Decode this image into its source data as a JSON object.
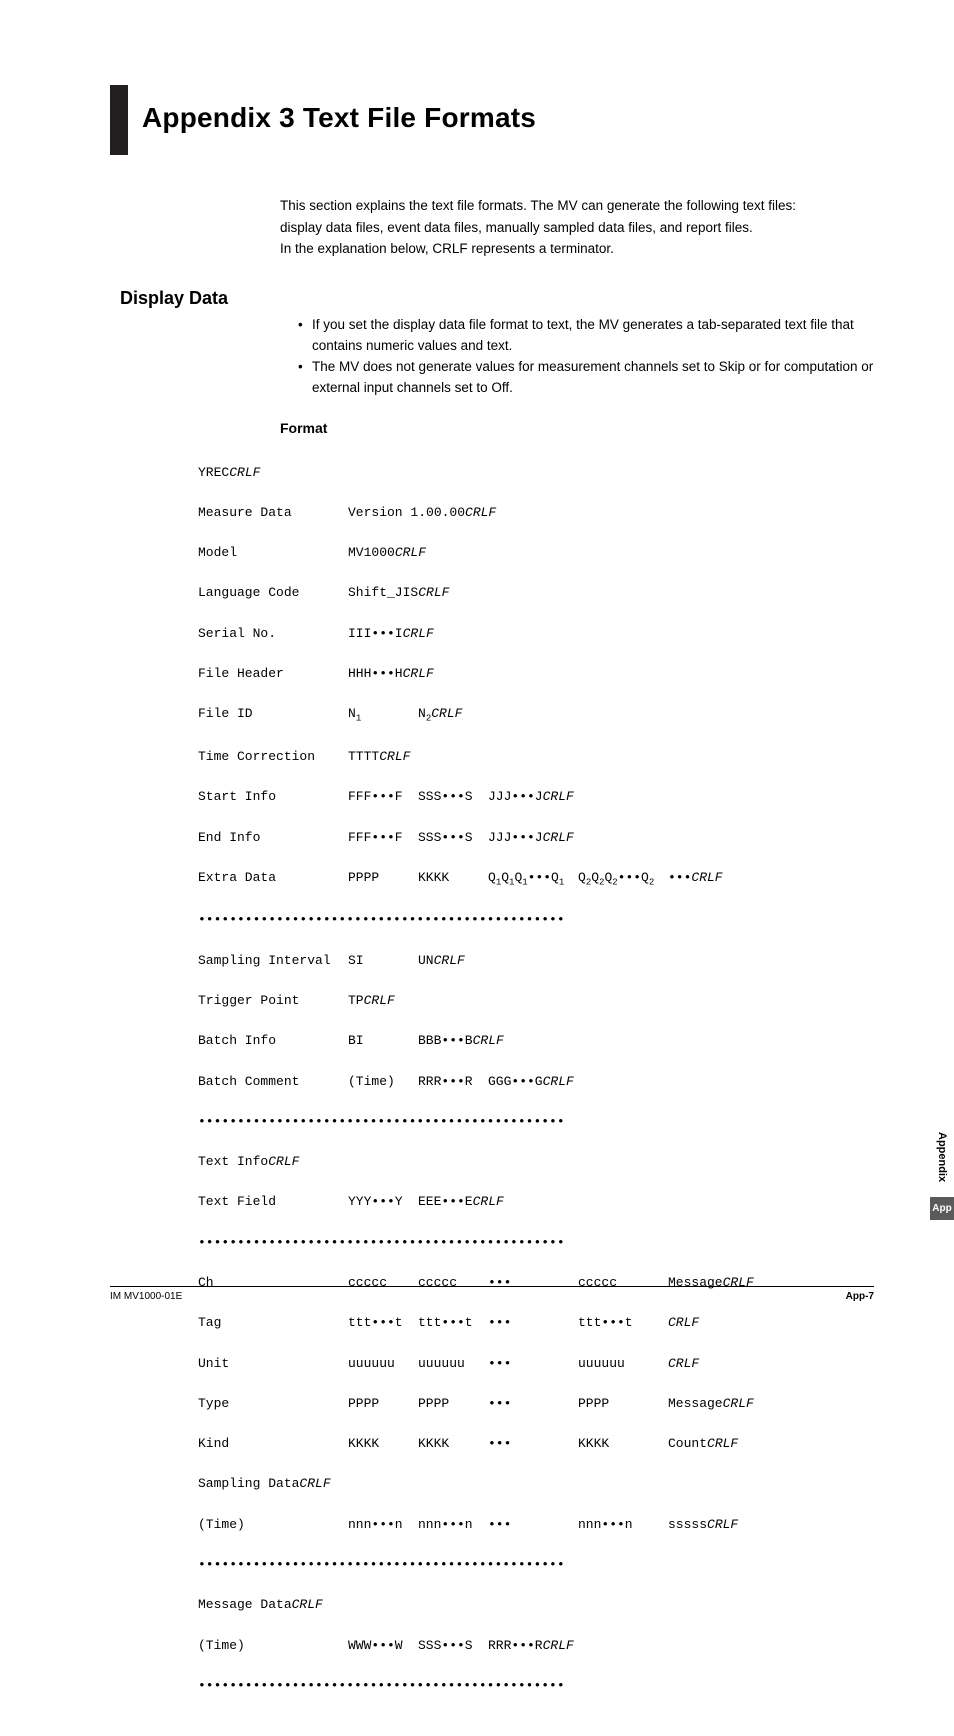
{
  "heading": "Appendix 3  Text File Formats",
  "intro_lines": [
    "This section explains the text file formats. The MV can generate the following text files:",
    "display data files, event data files, manually sampled data files, and report files.",
    "In the explanation below, CRLF represents a terminator."
  ],
  "h2": "Display Data",
  "bullets": [
    "If you set the display data file format to text, the MV generates a tab-separated text file that contains numeric values and text.",
    "The MV does not generate values for measurement channels set to Skip or for computation or external input channels set to Off."
  ],
  "h3": "Format",
  "fmt": {
    "r1": {
      "t": "YREC"
    },
    "r2": {
      "l": "Measure Data",
      "c1": "Version 1.00.00"
    },
    "r3": {
      "l": "Model",
      "c1": "MV1000"
    },
    "r4": {
      "l": "Language Code",
      "c1": "Shift_JIS"
    },
    "r5": {
      "l": "Serial No.",
      "c1": "III•••I"
    },
    "r6": {
      "l": "File Header",
      "c1": "HHH•••H"
    },
    "r7": {
      "l": "File ID",
      "c1": "N",
      "c2": "N"
    },
    "r8": {
      "l": "Time Correction",
      "c1": "TTTT"
    },
    "r9": {
      "l": "Start Info",
      "c1": "FFF•••F",
      "c2": "SSS•••S",
      "c3": "JJJ•••J"
    },
    "r10": {
      "l": "End Info",
      "c1": "FFF•••F",
      "c2": "SSS•••S",
      "c3": "JJJ•••J"
    },
    "r11": {
      "l": "Extra Data",
      "c1": "PPPP",
      "c2": "KKKK",
      "c3": "Q",
      "c4": "Q",
      "c5": "•••"
    },
    "sep": "•••••••••••••••••••••••••••••••••••••••••••••••",
    "r12": {
      "l": "Sampling Interval",
      "c1": "SI",
      "c2": "UN"
    },
    "r13": {
      "l": "Trigger Point",
      "c1": "TP"
    },
    "r14": {
      "l": "Batch Info",
      "c1": "BI",
      "c2": "BBB•••B"
    },
    "r15": {
      "l": "Batch Comment",
      "c1": "(Time)",
      "c2": "RRR•••R",
      "c3": "GGG•••G"
    },
    "r16": {
      "l": "Text Info"
    },
    "r17": {
      "l": "Text Field",
      "c1": "YYY•••Y",
      "c2": "EEE•••E"
    },
    "r18": {
      "l": "Ch",
      "c1": "ccccc",
      "c2": "ccccc",
      "c3": "•••",
      "c4": "ccccc",
      "c5": "Message"
    },
    "r19": {
      "l": "Tag",
      "c1": "ttt•••t",
      "c2": "ttt•••t",
      "c3": "•••",
      "c4": "ttt•••t",
      "c5": ""
    },
    "r20": {
      "l": "Unit",
      "c1": "uuuuuu",
      "c2": "uuuuuu",
      "c3": "•••",
      "c4": "uuuuuu",
      "c5": ""
    },
    "r21": {
      "l": "Type",
      "c1": "PPPP",
      "c2": "PPPP",
      "c3": "•••",
      "c4": "PPPP",
      "c5": "Message"
    },
    "r22": {
      "l": "Kind",
      "c1": "KKKK",
      "c2": "KKKK",
      "c3": "•••",
      "c4": "KKKK",
      "c5": "Count"
    },
    "r23": {
      "l": "Sampling Data"
    },
    "r24": {
      "l": "(Time)",
      "c1": "nnn•••n",
      "c2": "nnn•••n",
      "c3": "•••",
      "c4": "nnn•••n",
      "c5": "sssss"
    },
    "r25": {
      "l": "Message Data"
    },
    "r26": {
      "l": "(Time)",
      "c1": "WWW•••W",
      "c2": "SSS•••S",
      "c3": "RRR•••R"
    }
  },
  "side": {
    "label": "Appendix",
    "box": "App"
  },
  "footer": {
    "left": "IM MV1000-01E",
    "right": "App-7"
  }
}
